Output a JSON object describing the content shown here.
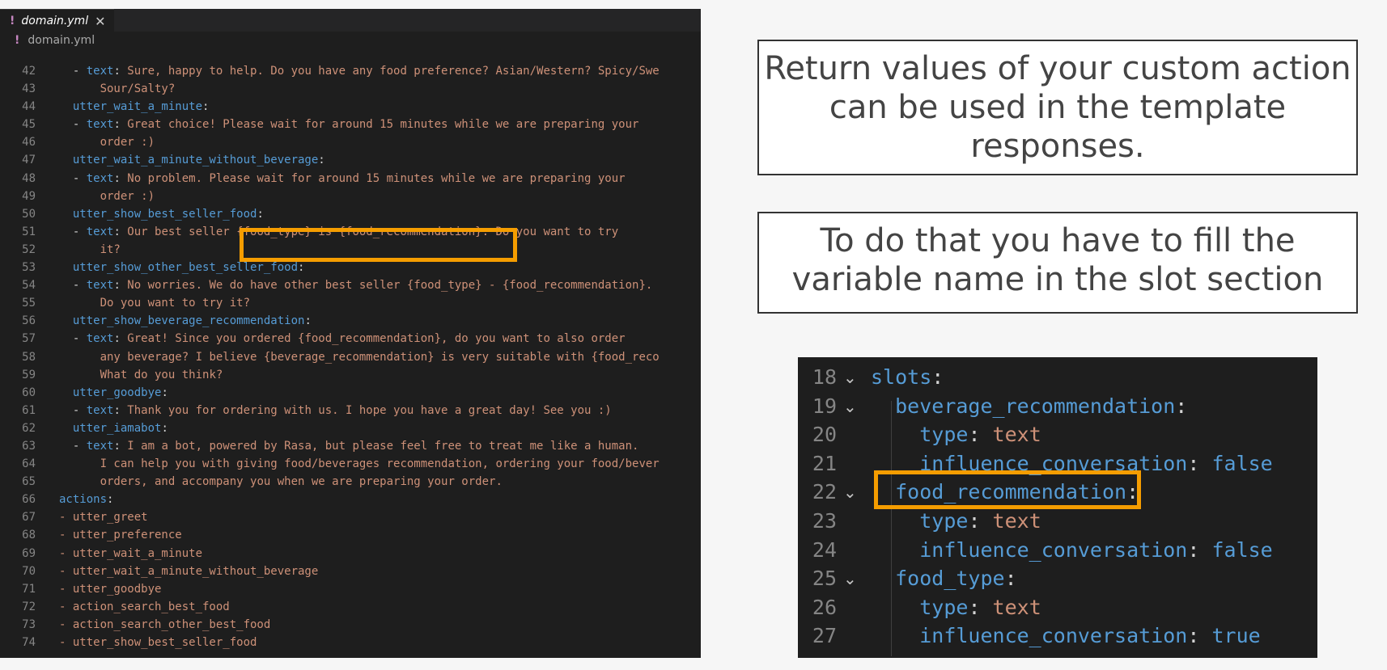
{
  "editor": {
    "tab_title": "domain.yml",
    "breadcrumb": "domain.yml",
    "lines": [
      {
        "num": "42",
        "indent": "  ",
        "key": "- text",
        "val": "Sure, happy to help. Do you have any food preference? Asian/Western? Spicy/Swe"
      },
      {
        "num": "43",
        "indent": "      ",
        "key": "",
        "val": "Sour/Salty?"
      },
      {
        "num": "44",
        "indent": "  ",
        "key": "utter_wait_a_minute",
        "val": ""
      },
      {
        "num": "45",
        "indent": "  ",
        "key": "- text",
        "val": "Great choice! Please wait for around 15 minutes while we are preparing your"
      },
      {
        "num": "46",
        "indent": "      ",
        "key": "",
        "val": "order :)"
      },
      {
        "num": "47",
        "indent": "  ",
        "key": "utter_wait_a_minute_without_beverage",
        "val": ""
      },
      {
        "num": "48",
        "indent": "  ",
        "key": "- text",
        "val": "No problem. Please wait for around 15 minutes while we are preparing your"
      },
      {
        "num": "49",
        "indent": "      ",
        "key": "",
        "val": "order :)"
      },
      {
        "num": "50",
        "indent": "  ",
        "key": "utter_show_best_seller_food",
        "val": ""
      },
      {
        "num": "51",
        "indent": "  ",
        "key": "- text",
        "val": "Our best seller {food_type} is {food_recommendation}. Do you want to try"
      },
      {
        "num": "52",
        "indent": "      ",
        "key": "",
        "val": "it?"
      },
      {
        "num": "53",
        "indent": "  ",
        "key": "utter_show_other_best_seller_food",
        "val": ""
      },
      {
        "num": "54",
        "indent": "  ",
        "key": "- text",
        "val": "No worries. We do have other best seller {food_type} - {food_recommendation}."
      },
      {
        "num": "55",
        "indent": "      ",
        "key": "",
        "val": "Do you want to try it?"
      },
      {
        "num": "56",
        "indent": "  ",
        "key": "utter_show_beverage_recommendation",
        "val": ""
      },
      {
        "num": "57",
        "indent": "  ",
        "key": "- text",
        "val": "Great! Since you ordered {food_recommendation}, do you want to also order"
      },
      {
        "num": "58",
        "indent": "      ",
        "key": "",
        "val": "any beverage? I believe {beverage_recommendation} is very suitable with {food_reco"
      },
      {
        "num": "59",
        "indent": "      ",
        "key": "",
        "val": "What do you think?"
      },
      {
        "num": "60",
        "indent": "  ",
        "key": "utter_goodbye",
        "val": ""
      },
      {
        "num": "61",
        "indent": "  ",
        "key": "- text",
        "val": "Thank you for ordering with us. I hope you have a great day! See you :)"
      },
      {
        "num": "62",
        "indent": "  ",
        "key": "utter_iamabot",
        "val": ""
      },
      {
        "num": "63",
        "indent": "  ",
        "key": "- text",
        "val": "I am a bot, powered by Rasa, but please feel free to treat me like a human."
      },
      {
        "num": "64",
        "indent": "      ",
        "key": "",
        "val": "I can help you with giving food/beverages recommendation, ordering your food/bever"
      },
      {
        "num": "65",
        "indent": "      ",
        "key": "",
        "val": "orders, and accompany you when we are preparing your order."
      },
      {
        "num": "66",
        "indent": "",
        "key": "actions",
        "val": ""
      },
      {
        "num": "67",
        "indent": "",
        "key": "",
        "val": "- utter_greet"
      },
      {
        "num": "68",
        "indent": "",
        "key": "",
        "val": "- utter_preference"
      },
      {
        "num": "69",
        "indent": "",
        "key": "",
        "val": "- utter_wait_a_minute"
      },
      {
        "num": "70",
        "indent": "",
        "key": "",
        "val": "- utter_wait_a_minute_without_beverage"
      },
      {
        "num": "71",
        "indent": "",
        "key": "",
        "val": "- utter_goodbye"
      },
      {
        "num": "72",
        "indent": "",
        "key": "",
        "val": "- action_search_best_food"
      },
      {
        "num": "73",
        "indent": "",
        "key": "",
        "val": "- action_search_other_best_food"
      },
      {
        "num": "74",
        "indent": "",
        "key": "",
        "val": "- utter_show_best_seller_food"
      }
    ]
  },
  "callouts": {
    "first": [
      "Return values of your custom action",
      "can be used in the template",
      "responses."
    ],
    "second": [
      "To do that you have to fill the",
      "variable name in the slot section"
    ]
  },
  "slots_panel": {
    "lines": [
      {
        "num": "18",
        "fold": true,
        "indent": "",
        "key": "slots",
        "val": ""
      },
      {
        "num": "19",
        "fold": true,
        "indent": "  ",
        "key": "beverage_recommendation",
        "val": ""
      },
      {
        "num": "20",
        "fold": false,
        "indent": "    ",
        "key": "type",
        "val": "text"
      },
      {
        "num": "21",
        "fold": false,
        "indent": "    ",
        "key": "influence_conversation",
        "val": "false"
      },
      {
        "num": "22",
        "fold": true,
        "indent": "  ",
        "key": "food_recommendation",
        "val": ""
      },
      {
        "num": "23",
        "fold": false,
        "indent": "    ",
        "key": "type",
        "val": "text"
      },
      {
        "num": "24",
        "fold": false,
        "indent": "    ",
        "key": "influence_conversation",
        "val": "false"
      },
      {
        "num": "25",
        "fold": true,
        "indent": "  ",
        "key": "food_type",
        "val": ""
      },
      {
        "num": "26",
        "fold": false,
        "indent": "    ",
        "key": "type",
        "val": "text"
      },
      {
        "num": "27",
        "fold": false,
        "indent": "    ",
        "key": "influence_conversation",
        "val": "true"
      }
    ]
  },
  "colors": {
    "highlight": "#f59d00",
    "key": "#569cd6",
    "string": "#ce9178",
    "line_number": "#858585"
  },
  "icons": {
    "file_icon": "yaml-exclamation-icon",
    "close_icon": "close-icon",
    "fold_icon": "chevron-down-icon"
  }
}
